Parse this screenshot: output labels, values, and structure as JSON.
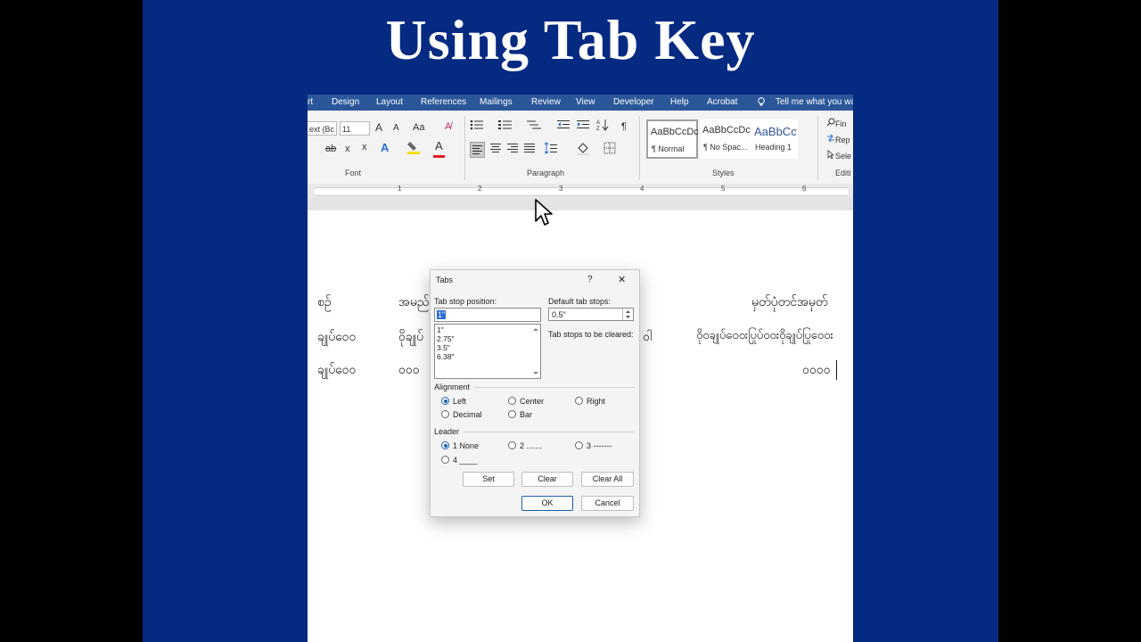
{
  "headline": "Using Tab Key",
  "ribbon_tabs": [
    "rt",
    "Design",
    "Layout",
    "References",
    "Mailings",
    "Review",
    "View",
    "Developer",
    "Help",
    "Acrobat",
    "Tell me what you wa"
  ],
  "font": {
    "family_value": "ext (Bc",
    "size_value": "11",
    "group_label": "Font",
    "grow_label": "A",
    "shrink_label": "A",
    "case_label": "Aa",
    "strike_label": "ab",
    "sub_label": "x",
    "sup_label": "x",
    "effects_label": "A",
    "color_label": "A"
  },
  "paragraph": {
    "group_label": "Paragraph",
    "pilcrow": "¶"
  },
  "styles": {
    "group_label": "Styles",
    "cards": [
      {
        "sample": "AaBbCcDc",
        "name": "¶ Normal"
      },
      {
        "sample": "AaBbCcDc",
        "name": "¶ No Spac..."
      },
      {
        "sample": "AaBbCc",
        "name": "Heading 1"
      }
    ]
  },
  "editing": {
    "group_label": "Editi",
    "find": "Fin",
    "replace": "Rep",
    "select": "Sele"
  },
  "ruler_numbers": [
    "1",
    "2",
    "3",
    "4",
    "5",
    "6"
  ],
  "document": {
    "row1_left": "စဉ်",
    "row1_mid": "အမည်",
    "row1_right": "မှတ်ပုံတင်အမှတ်",
    "row2_left": "ချုပ်ဝေဝ",
    "row2_mid": "ဝိုချုပ်",
    "row2_after": "ဝါ",
    "row2_right": "ဝိုဝချုပ်ဝေဝးပြုပ်ဝဝးဝိုချုပ်ပြုဝေဝး",
    "row3_left": "ချုပ်ဝေဝ",
    "row3_mid": "ဝဝဝ",
    "row3_right": "ဝဝဝဝ"
  },
  "dialog": {
    "title": "Tabs",
    "help": "?",
    "close": "✕",
    "tab_stop_label": "Tab stop position:",
    "tab_stop_value": "1\"",
    "tab_stops": [
      "1\"",
      "2.75\"",
      "3.5\"",
      "6.38\""
    ],
    "default_label": "Default tab stops:",
    "default_value": "0.5\"",
    "cleared_label": "Tab stops to be cleared:",
    "alignment_label": "Alignment",
    "alignment": {
      "left": "Left",
      "center": "Center",
      "right": "Right",
      "decimal": "Decimal",
      "bar": "Bar"
    },
    "leader_label": "Leader",
    "leader": {
      "none": "1 None",
      "dots": "2 .......",
      "dashes": "3 -------",
      "under": "4 ____"
    },
    "set": "Set",
    "clear": "Clear",
    "clear_all": "Clear All",
    "ok": "OK",
    "cancel": "Cancel"
  },
  "colors": {
    "slide_bg": "#052a82",
    "ribbon_tabs_bg": "#2b579a",
    "ribbon_bg": "#f3f3f3",
    "accent": "#1a5fb4"
  }
}
